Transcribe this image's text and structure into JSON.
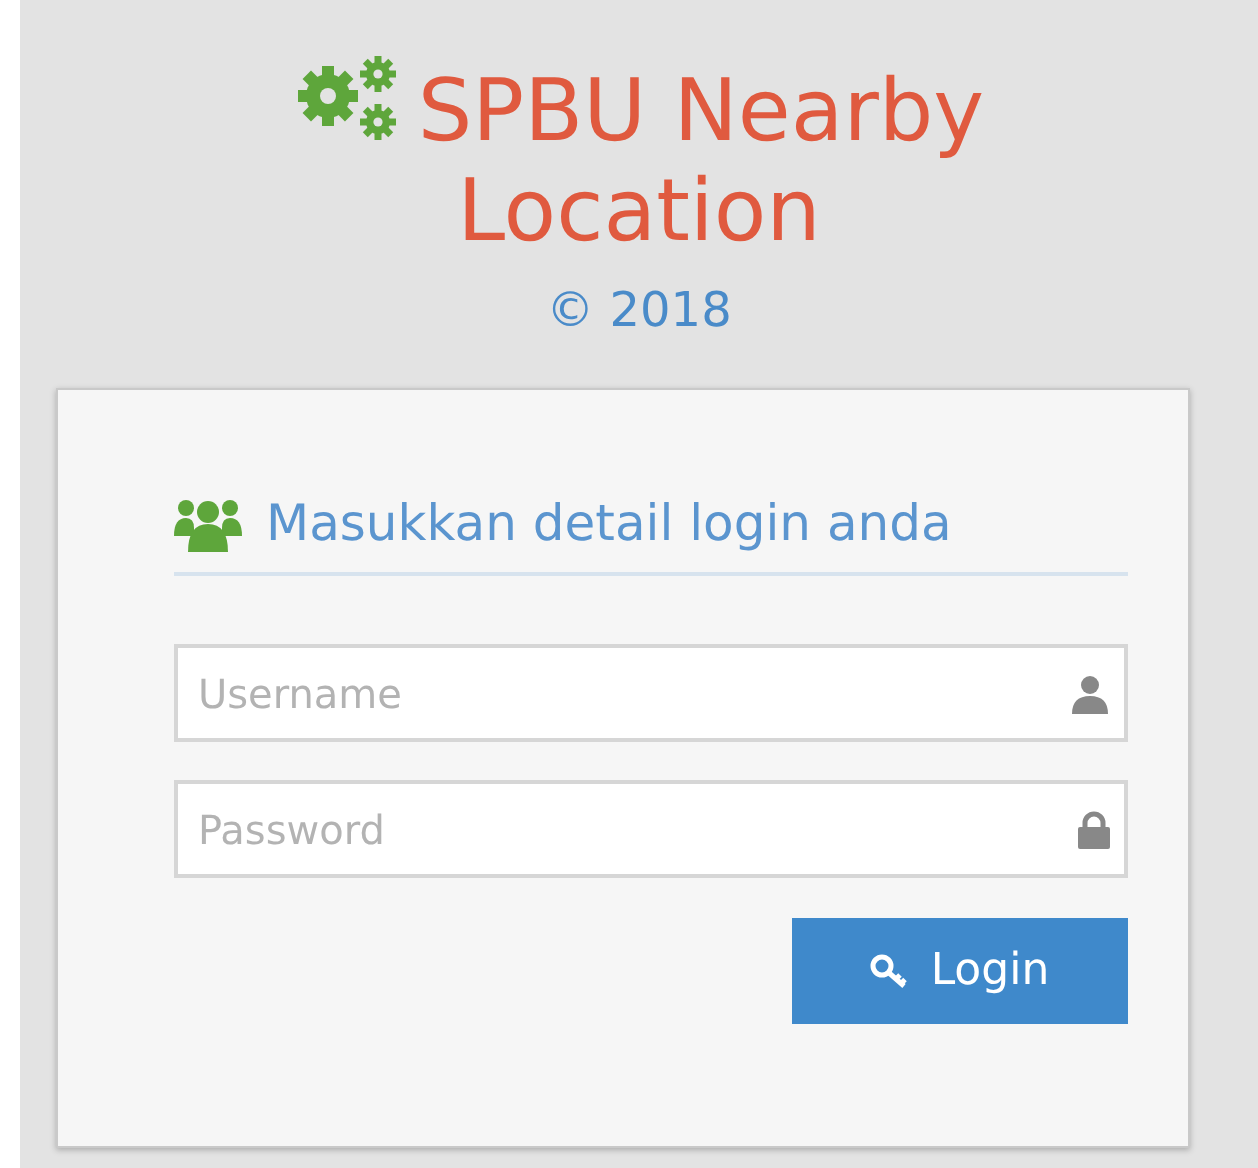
{
  "header": {
    "title": "SPBU Nearby Location",
    "copyright": "© 2018"
  },
  "login_form": {
    "heading": "Masukkan detail login anda",
    "fields": [
      {
        "kind": "username",
        "placeholder": "Username"
      },
      {
        "kind": "password",
        "placeholder": "Password"
      }
    ],
    "button": {
      "label": "Login"
    }
  }
}
